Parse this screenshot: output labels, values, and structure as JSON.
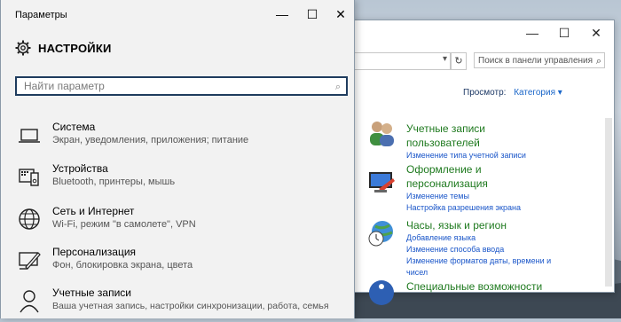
{
  "control_panel": {
    "window_controls": {
      "minimize": "—",
      "maximize": "☐",
      "close": "✕"
    },
    "address_dropdown_icon": "chevron-down-icon",
    "search_placeholder": "Поиск в панели управления",
    "view_label": "Просмотр:",
    "view_value": "Категория ▾",
    "categories": [
      {
        "title_line1": "Учетные записи",
        "title_line2": "пользователей",
        "links": [
          "Изменение типа учетной записи"
        ]
      },
      {
        "title_line1": "Оформление и",
        "title_line2": "персонализация",
        "links": [
          "Изменение темы",
          "Настройка разрешения экрана"
        ]
      },
      {
        "title_line1": "Часы, язык и регион",
        "title_line2": "",
        "links": [
          "Добавление языка",
          "Изменение способа ввода",
          "Изменение форматов даты, времени и",
          "чисел"
        ]
      },
      {
        "title_line1": "Специальные возможности",
        "title_line2": "",
        "links": []
      }
    ]
  },
  "settings": {
    "title": "Параметры",
    "window_controls": {
      "minimize": "—",
      "maximize": "☐",
      "close": "✕"
    },
    "header": "НАСТРОЙКИ",
    "search_placeholder": "Найти параметр",
    "items": [
      {
        "title": "Система",
        "subtitle": "Экран, уведомления, приложения; питание",
        "icon": "laptop-icon"
      },
      {
        "title": "Устройства",
        "subtitle": "Bluetooth, принтеры, мышь",
        "icon": "devices-icon"
      },
      {
        "title": "Сеть и Интернет",
        "subtitle": "Wi-Fi, режим \"в самолете\", VPN",
        "icon": "globe-icon"
      },
      {
        "title": "Персонализация",
        "subtitle": "Фон, блокировка экрана, цвета",
        "icon": "paint-icon"
      },
      {
        "title": "Учетные записи",
        "subtitle": "Ваша учетная запись, настройки синхронизации, работа, семья",
        "icon": "user-icon"
      }
    ]
  }
}
